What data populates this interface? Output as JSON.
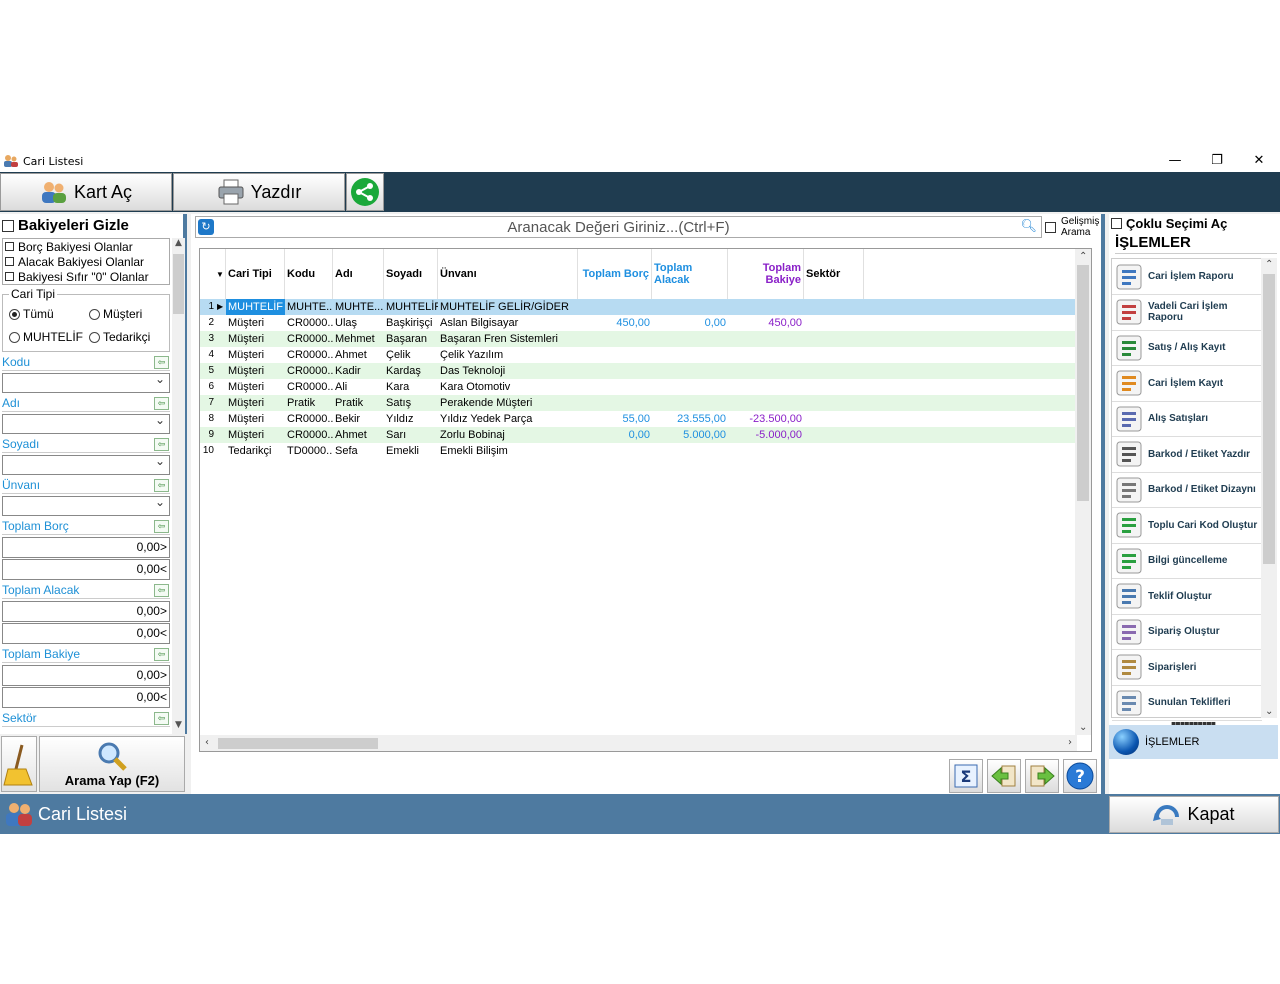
{
  "window": {
    "title": "Cari Listesi"
  },
  "toolbar": {
    "kart_ac": "Kart Aç",
    "yazdir": "Yazdır"
  },
  "left": {
    "hide_balances": "Bakiyeleri Gizle",
    "filters": [
      "Borç Bakiyesi Olanlar",
      "Alacak Bakiyesi Olanlar",
      "Bakiyesi Sıfır \"0\" Olanlar"
    ],
    "cari_tipi": {
      "legend": "Cari Tipi",
      "tumu": "Tümü",
      "musteri": "Müşteri",
      "muhtelif": "MUHTELİF",
      "tedarikci": "Tedarikçi"
    },
    "fields": {
      "kodu": "Kodu",
      "adi": "Adı",
      "soyadi": "Soyadı",
      "unvani": "Ünvanı",
      "toplam_borc": "Toplam Borç",
      "toplam_alacak": "Toplam Alacak",
      "toplam_bakiye": "Toplam Bakiye",
      "sektor": "Sektör"
    },
    "range": {
      "borc_min": "0,00>",
      "borc_max": "0,00<",
      "alacak_min": "0,00>",
      "alacak_max": "0,00<",
      "bakiye_min": "0,00>",
      "bakiye_max": "0,00<"
    },
    "search_button": "Arama Yap (F2)"
  },
  "search": {
    "placeholder": "Aranacak Değeri Giriniz...(Ctrl+F)",
    "advanced": "Gelişmiş Arama"
  },
  "grid": {
    "headers": {
      "cari_tipi": "Cari Tipi",
      "kodu": "Kodu",
      "adi": "Adı",
      "soyadi": "Soyadı",
      "unvani": "Ünvanı",
      "toplam_borc": "Toplam Borç",
      "toplam_alacak": "Toplam Alacak",
      "toplam_bakiye": "Toplam Bakiye",
      "sektor": "Sektör"
    },
    "rows": [
      {
        "no": "1",
        "tip": "MUHTELİF",
        "kod": "MUHTE...",
        "adi": "MUHTE...",
        "soyadi": "MUHTELİF",
        "unvan": "MUHTELİF GELİR/GİDER",
        "borc": "",
        "alacak": "",
        "bakiye": ""
      },
      {
        "no": "2",
        "tip": "Müşteri",
        "kod": "CR0000...",
        "adi": "Ulaş",
        "soyadi": "Başkirişçi",
        "unvan": "Aslan Bilgisayar",
        "borc": "450,00",
        "alacak": "0,00",
        "bakiye": "450,00"
      },
      {
        "no": "3",
        "tip": "Müşteri",
        "kod": "CR0000...",
        "adi": "Mehmet",
        "soyadi": "Başaran",
        "unvan": "Başaran Fren Sistemleri",
        "borc": "",
        "alacak": "",
        "bakiye": ""
      },
      {
        "no": "4",
        "tip": "Müşteri",
        "kod": "CR0000...",
        "adi": "Ahmet",
        "soyadi": "Çelik",
        "unvan": "Çelik Yazılım",
        "borc": "",
        "alacak": "",
        "bakiye": ""
      },
      {
        "no": "5",
        "tip": "Müşteri",
        "kod": "CR0000...",
        "adi": "Kadir",
        "soyadi": "Kardaş",
        "unvan": "Das Teknoloji",
        "borc": "",
        "alacak": "",
        "bakiye": ""
      },
      {
        "no": "6",
        "tip": "Müşteri",
        "kod": "CR0000...",
        "adi": "Ali",
        "soyadi": "Kara",
        "unvan": "Kara Otomotiv",
        "borc": "",
        "alacak": "",
        "bakiye": ""
      },
      {
        "no": "7",
        "tip": "Müşteri",
        "kod": "Pratik",
        "adi": "Pratik",
        "soyadi": "Satış",
        "unvan": "Perakende Müşteri",
        "borc": "",
        "alacak": "",
        "bakiye": ""
      },
      {
        "no": "8",
        "tip": "Müşteri",
        "kod": "CR0000...",
        "adi": "Bekir",
        "soyadi": "Yıldız",
        "unvan": "Yıldız Yedek Parça",
        "borc": "55,00",
        "alacak": "23.555,00",
        "bakiye": "-23.500,00"
      },
      {
        "no": "9",
        "tip": "Müşteri",
        "kod": "CR0000...",
        "adi": "Ahmet",
        "soyadi": "Sarı",
        "unvan": "Zorlu Bobinaj",
        "borc": "0,00",
        "alacak": "5.000,00",
        "bakiye": "-5.000,00"
      },
      {
        "no": "10",
        "tip": "Tedarikçi",
        "kod": "TD0000...",
        "adi": "Sefa",
        "soyadi": "Emekli",
        "unvan": "Emekli Bilişim",
        "borc": "",
        "alacak": "",
        "bakiye": ""
      }
    ]
  },
  "right": {
    "multi_select": "Çoklu Seçimi Aç",
    "header": "İŞLEMLER",
    "ops": [
      "Cari İşlem Raporu",
      "Vadeli Cari İşlem Raporu",
      "Satış / Alış Kayıt",
      "Cari İşlem Kayıt",
      "Alış Satışları",
      "Barkod / Etiket Yazdır",
      "Barkod / Etiket Dizaynı",
      "Toplu Cari Kod Oluştur",
      "Bilgi güncelleme",
      "Teklif Oluştur",
      "Sipariş Oluştur",
      "Siparişleri",
      "Sunulan Teklifleri"
    ],
    "tab": "İŞLEMLER"
  },
  "status": {
    "title": "Cari Listesi",
    "close": "Kapat"
  }
}
